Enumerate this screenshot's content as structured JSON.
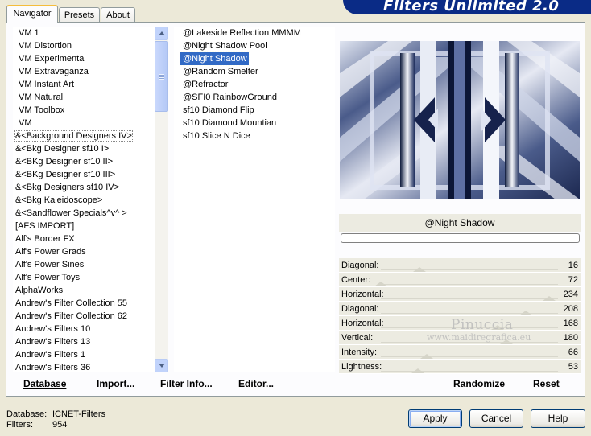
{
  "tabs": [
    {
      "label": "Navigator"
    },
    {
      "label": "Presets"
    },
    {
      "label": "About"
    }
  ],
  "banner": {
    "title": "Filters Unlimited 2.0"
  },
  "categories": [
    "VM 1",
    "VM Distortion",
    "VM Experimental",
    "VM Extravaganza",
    "VM Instant Art",
    "VM Natural",
    "VM Toolbox",
    "VM",
    "&<Background Designers IV>",
    "&<Bkg Designer sf10 I>",
    "&<BKg Designer sf10 II>",
    "&<BKg Designer sf10 III>",
    "&<Bkg Designers sf10 IV>",
    "&<Bkg Kaleidoscope>",
    "&<Sandflower Specials^v^ >",
    "[AFS IMPORT]",
    "Alf's Border FX",
    "Alf's Power Grads",
    "Alf's Power Sines",
    "Alf's Power Toys",
    "AlphaWorks",
    "Andrew's Filter Collection 55",
    "Andrew's Filter Collection 62",
    "Andrew's Filters 10",
    "Andrew's Filters 13",
    "Andrew's Filters 1",
    "Andrew's Filters 36"
  ],
  "filters": [
    "@Lakeside Reflection MMMM",
    "@Night Shadow Pool",
    "@Night Shadow",
    "@Random Smelter",
    "@Refractor",
    "@SFI0 RainbowGround",
    "sf10 Diamond Flip",
    "sf10 Diamond Mountian",
    "sf10 Slice N Dice"
  ],
  "toolbar": {
    "database": "Database",
    "import": "Import...",
    "filter_info": "Filter Info...",
    "editor": "Editor..."
  },
  "preview": {
    "filter_name": "@Night Shadow"
  },
  "params": [
    {
      "label": "Diagonal:",
      "value": "16"
    },
    {
      "label": "Center:",
      "value": "72"
    },
    {
      "label": "Horizontal:",
      "value": "234"
    },
    {
      "label": "Diagonal:",
      "value": "208"
    },
    {
      "label": "Horizontal:",
      "value": "168"
    },
    {
      "label": "Vertical:",
      "value": "180"
    },
    {
      "label": "Intensity:",
      "value": "66"
    },
    {
      "label": "Lightness:",
      "value": "53"
    }
  ],
  "right_toolbar": {
    "randomize": "Randomize",
    "reset": "Reset"
  },
  "watermark": {
    "name": "Pinuccia",
    "site": "www.maidiregrafica.eu"
  },
  "status": {
    "database_label": "Database:",
    "database_value": "ICNET-Filters",
    "filters_label": "Filters:",
    "filters_value": "954"
  },
  "buttons": {
    "apply": "Apply",
    "cancel": "Cancel",
    "help": "Help"
  }
}
